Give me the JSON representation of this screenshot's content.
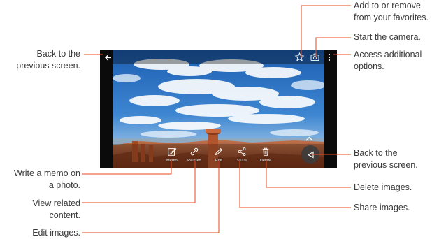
{
  "phone_screen": {
    "toolbar": {
      "memo_label": "Memo",
      "related_label": "Related",
      "edit_label": "Edit",
      "share_label": "Share",
      "delete_label": "Delete"
    },
    "icons": {
      "back": "back-arrow-icon",
      "favorite": "star-icon",
      "camera": "camera-icon",
      "more": "more-vertical-icon",
      "expand": "chevron-up-icon",
      "nav_back": "triangle-back-icon"
    }
  },
  "callouts": {
    "back_top": [
      "Back to the",
      "previous screen."
    ],
    "favorites": [
      "Add to or remove",
      "from your favorites."
    ],
    "camera": [
      "Start the camera."
    ],
    "more_options": [
      "Access additional",
      "options."
    ],
    "nav_back": [
      "Back to the",
      "previous screen."
    ],
    "memo": [
      "Write a memo on",
      "a photo."
    ],
    "related": [
      "View related",
      "content."
    ],
    "edit": [
      "Edit images."
    ],
    "delete": [
      "Delete images."
    ],
    "share": [
      "Share images."
    ]
  },
  "colors": {
    "callout_line": "#e8491d",
    "callout_text": "#3a3a3a",
    "sky": "#2f73c4",
    "rock": "#b3552c"
  }
}
